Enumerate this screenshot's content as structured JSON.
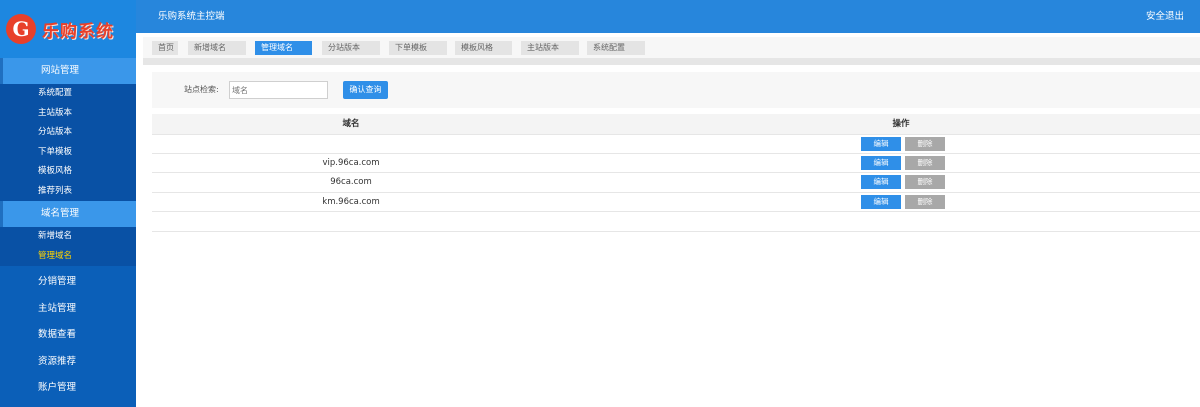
{
  "app": {
    "logo_letter": "G",
    "logo_text": "乐购系统",
    "header_title": "乐购系统主控端",
    "logout": "安全退出"
  },
  "sidebar": {
    "sections": [
      {
        "label": "网站管理",
        "items": [
          {
            "label": "系统配置"
          },
          {
            "label": "主站版本"
          },
          {
            "label": "分站版本"
          },
          {
            "label": "下单模板"
          },
          {
            "label": "模板风格"
          },
          {
            "label": "推荐列表"
          }
        ]
      },
      {
        "label": "域名管理",
        "items": [
          {
            "label": "新增域名"
          },
          {
            "label": "管理域名",
            "active": true
          }
        ]
      }
    ],
    "top_items": [
      {
        "label": "分销管理"
      },
      {
        "label": "主站管理"
      },
      {
        "label": "数据查看"
      },
      {
        "label": "资源推荐"
      },
      {
        "label": "账户管理"
      }
    ]
  },
  "tabs": [
    {
      "label": "首页"
    },
    {
      "label": "新增域名"
    },
    {
      "label": "管理域名",
      "active": true
    },
    {
      "label": "分站版本"
    },
    {
      "label": "下单模板"
    },
    {
      "label": "模板风格"
    },
    {
      "label": "主站版本"
    },
    {
      "label": "系统配置"
    }
  ],
  "search": {
    "label": "站点检索:",
    "placeholder": "域名",
    "button": "确认查询"
  },
  "table": {
    "headers": {
      "domain": "域名",
      "actions": "操作"
    },
    "edit_label": "编辑",
    "delete_label": "删除",
    "rows": [
      {
        "domain": ""
      },
      {
        "domain": "vip.96ca.com"
      },
      {
        "domain": "96ca.com"
      },
      {
        "domain": "km.96ca.com"
      }
    ]
  },
  "colors": {
    "sidebar_bg": "#0b5fb8",
    "header_bg": "#2786dc",
    "accent": "#2f8fe8",
    "active_text": "#ffd400",
    "delete_bg": "#a8a8a8"
  }
}
